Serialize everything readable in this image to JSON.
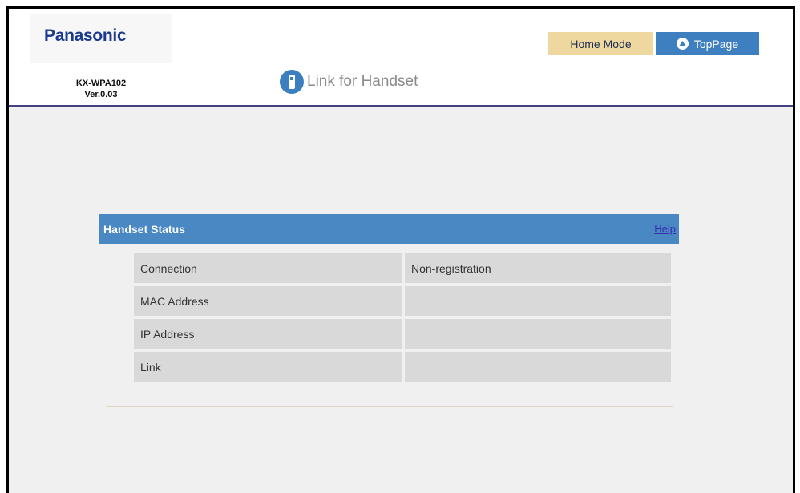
{
  "brand": {
    "logo_text": "Panasonic"
  },
  "device": {
    "model": "KX-WPA102",
    "version": "Ver.0.03"
  },
  "page": {
    "title": "Link for Handset",
    "title_icon": "handset-icon"
  },
  "nav": {
    "home_mode_label": "Home Mode",
    "top_page_label": "TopPage",
    "top_page_icon": "up-arrow-circle-icon"
  },
  "section": {
    "title": "Handset Status",
    "help_label": "Help",
    "rows": [
      {
        "label": "Connection",
        "value": "Non-registration"
      },
      {
        "label": "MAC Address",
        "value": ""
      },
      {
        "label": "IP Address",
        "value": ""
      },
      {
        "label": "Link",
        "value": ""
      }
    ]
  },
  "colors": {
    "accent_blue": "#4a88c4",
    "home_button": "#efd8a0",
    "header_rule": "#40417e",
    "logo": "#1b3a8f",
    "help_link": "#3b2db0"
  }
}
